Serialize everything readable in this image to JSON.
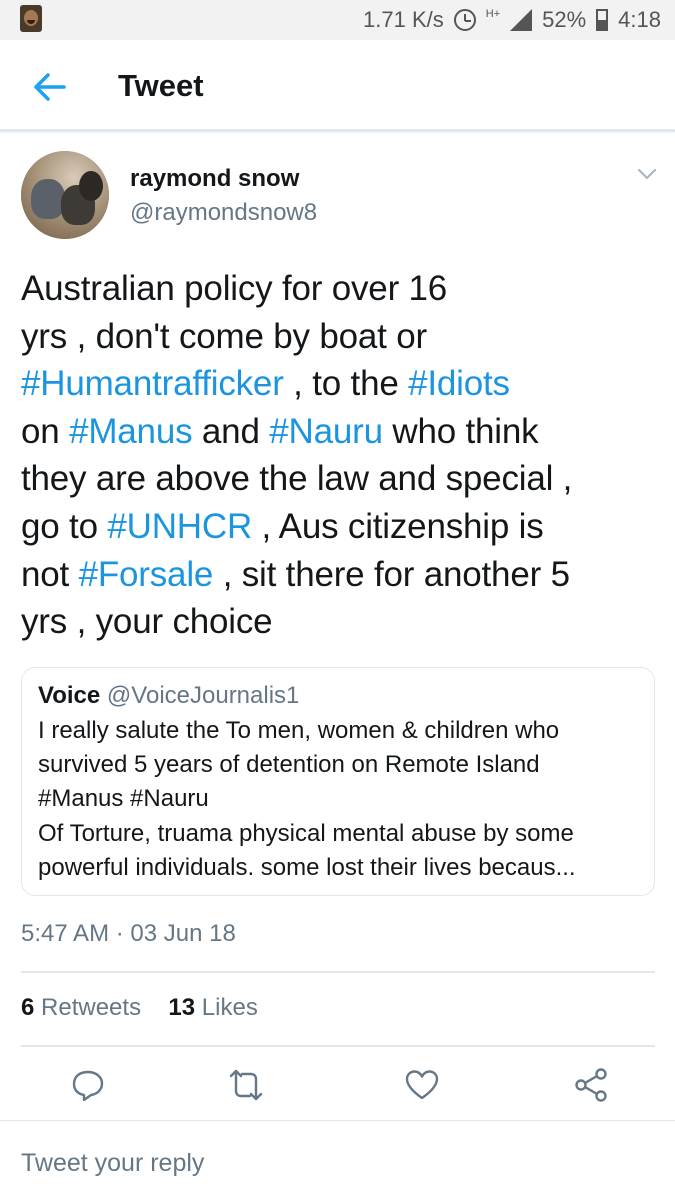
{
  "status_bar": {
    "net_speed": "1.71 K/s",
    "net_type": "H+",
    "battery": "52%",
    "time": "4:18",
    "icons": [
      "app-notification-icon",
      "alarm-icon",
      "signal-icon",
      "battery-icon"
    ]
  },
  "header": {
    "title": "Tweet",
    "back_icon": "back-arrow-icon"
  },
  "tweet": {
    "author_name": "raymond snow",
    "author_handle": "@raymondsnow8",
    "text_lines": [
      [
        {
          "t": "Australian policy for over 16"
        }
      ],
      [
        {
          "t": "yrs , don't come by boat or"
        }
      ],
      [
        {
          "t": "#Humantrafficker",
          "tag": true
        },
        {
          "t": " , to the "
        },
        {
          "t": "#Idiots",
          "tag": true
        }
      ],
      [
        {
          "t": "on "
        },
        {
          "t": "#Manus",
          "tag": true
        },
        {
          "t": " and "
        },
        {
          "t": "#Nauru",
          "tag": true
        },
        {
          "t": " who think"
        }
      ],
      [
        {
          "t": "they are above the law and special ,"
        }
      ],
      [
        {
          "t": "go to "
        },
        {
          "t": "#UNHCR",
          "tag": true
        },
        {
          "t": " , Aus citizenship is"
        }
      ],
      [
        {
          "t": "not "
        },
        {
          "t": "#Forsale",
          "tag": true
        },
        {
          "t": " , sit there for another 5"
        }
      ],
      [
        {
          "t": "yrs , your choice"
        }
      ]
    ],
    "timestamp": "5:47 AM · 03 Jun 18"
  },
  "quote": {
    "name": "Voice",
    "handle": "@VoiceJournalis1",
    "lines": [
      "I really salute the To men, women & children who",
      "survived 5 years of detention on Remote Island",
      "#Manus #Nauru",
      "Of Torture, truama  physical mental abuse by some",
      "powerful individuals. some lost their lives becaus..."
    ]
  },
  "stats": {
    "retweets_count": "6",
    "retweets_label": "Retweets",
    "likes_count": "13",
    "likes_label": "Likes"
  },
  "actions": [
    "reply-icon",
    "retweet-icon",
    "like-icon",
    "share-icon"
  ],
  "reply": {
    "placeholder": "Tweet your reply"
  },
  "colors": {
    "accent": "#1b95e0",
    "text": "#14171a",
    "secondary": "#657786",
    "divider": "#e1e8ed",
    "back_arrow": "#1da1f2"
  }
}
